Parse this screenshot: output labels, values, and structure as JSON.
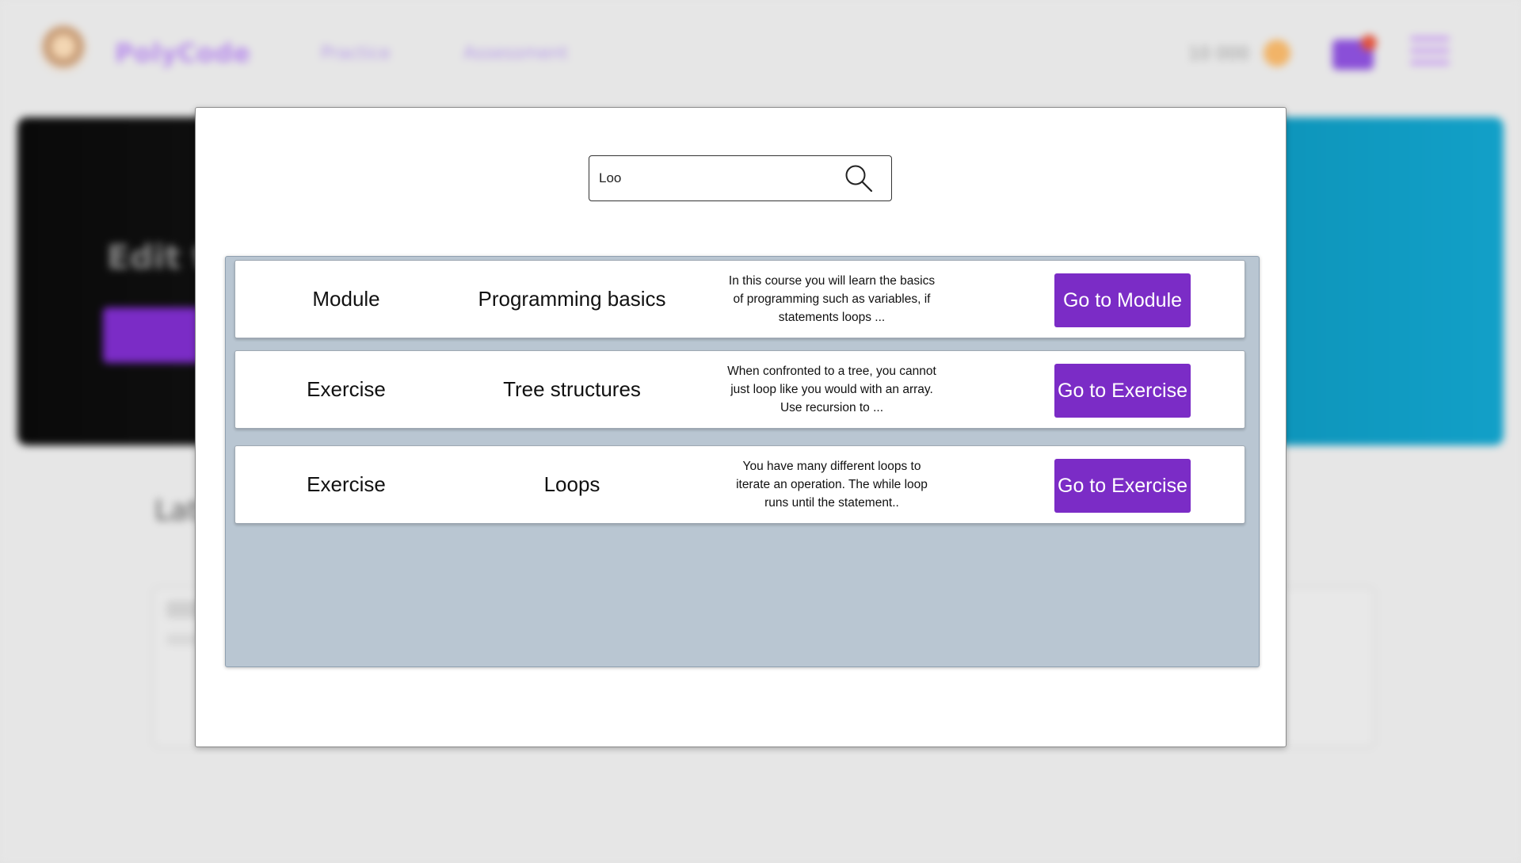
{
  "background": {
    "brand": "PolyCode",
    "nav": [
      "Practice",
      "Assessment"
    ],
    "coins": "10 000",
    "hero_title": "Edit the",
    "section_title": "Lat"
  },
  "search": {
    "value": "Loo",
    "icon": "search-icon"
  },
  "results": [
    {
      "type": "Module",
      "title": "Programming basics",
      "description": "In this course you will learn the basics of programming such as variables, if statements loops ...",
      "button_label": "Go to Module"
    },
    {
      "type": "Exercise",
      "title": "Tree structures",
      "description": "When confronted to a tree, you cannot just loop like you would with an array. Use recursion to ...",
      "button_label": "Go to Exercise"
    },
    {
      "type": "Exercise",
      "title": "Loops",
      "description": "You have many different loops to iterate an operation. The while loop runs until the statement..",
      "button_label": "Go to Exercise"
    }
  ],
  "colors": {
    "accent": "#7b2cc6",
    "results_panel": "#b9c6d2"
  }
}
